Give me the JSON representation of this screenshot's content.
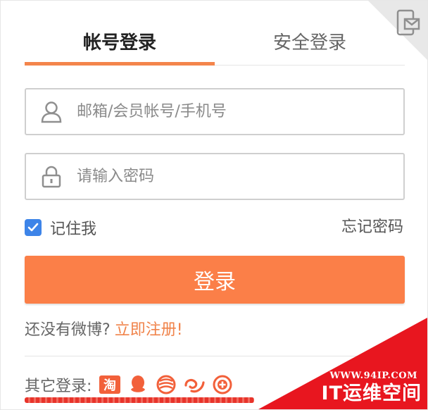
{
  "tabs": [
    {
      "label": "帐号登录",
      "active": true
    },
    {
      "label": "安全登录",
      "active": false
    }
  ],
  "form": {
    "username": {
      "placeholder": "邮箱/会员帐号/手机号",
      "value": ""
    },
    "password": {
      "placeholder": "请输入密码",
      "value": ""
    },
    "remember_label": "记住我",
    "remember_checked": true,
    "forgot_label": "忘记密码",
    "login_label": "登录"
  },
  "register": {
    "question": "还没有微博?",
    "link": "立即注册!"
  },
  "other_login": {
    "label": "其它登录:",
    "providers": [
      {
        "icon": "taobao-icon",
        "text": "淘"
      },
      {
        "icon": "qq-icon"
      },
      {
        "icon": "china-mobile-icon"
      },
      {
        "icon": "tianyi-icon"
      },
      {
        "icon": "add-icon"
      }
    ]
  },
  "watermark": {
    "url": "WWW.94IP.COM",
    "name": "IT运维空间"
  },
  "colors": {
    "accent": "#fb7f48",
    "link": "#f0834a",
    "checkbox": "#3d84e8",
    "watermark": "#e8161f"
  }
}
